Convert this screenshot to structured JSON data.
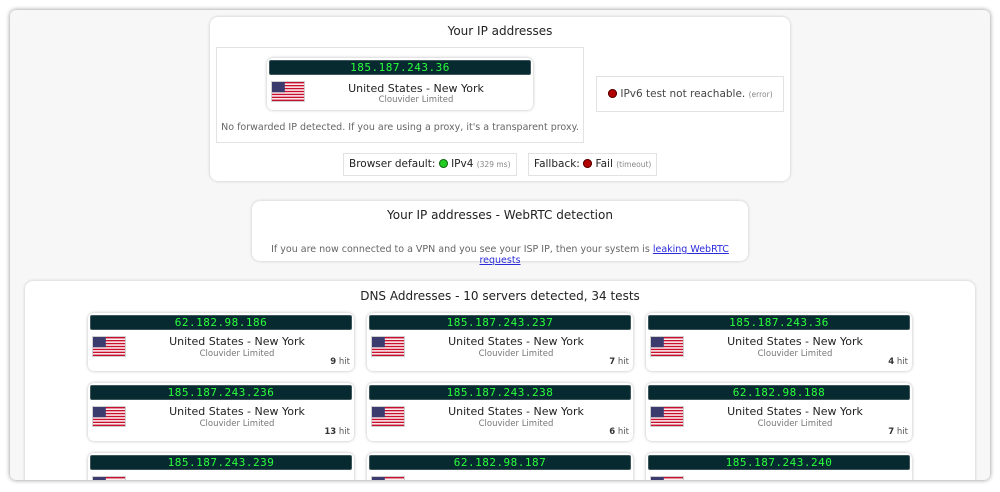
{
  "ip_panel": {
    "title": "Your IP addresses",
    "ipv4": {
      "ip": "185.187.243.36",
      "location": "United States - New York",
      "isp": "Clouvider Limited",
      "flag_icon": "us-flag-icon"
    },
    "forwarded_note": "No forwarded IP detected. If you are using a proxy, it's a transparent proxy.",
    "ipv6": {
      "text": "IPv6 test not reachable.",
      "detail": "(error)",
      "status_color": "#b30000"
    },
    "browser_default": {
      "label": "Browser default:",
      "protocol": "IPv4",
      "detail": "(329 ms)",
      "status_color": "#22cc22"
    },
    "fallback": {
      "label": "Fallback:",
      "result": "Fail",
      "detail": "(timeout)",
      "status_color": "#b30000"
    }
  },
  "webrtc_panel": {
    "title": "Your IP addresses - WebRTC detection",
    "note": "If you are now connected to a VPN and you see your ISP IP, then your system is",
    "link_text": "leaking WebRTC requests"
  },
  "dns_panel": {
    "title": "DNS Addresses - 10 servers detected, 34 tests",
    "hit_suffix": "hit",
    "servers": [
      {
        "ip": "62.182.98.186",
        "location": "United States - New York",
        "isp": "Clouvider Limited",
        "hits": "9"
      },
      {
        "ip": "185.187.243.237",
        "location": "United States - New York",
        "isp": "Clouvider Limited",
        "hits": "7"
      },
      {
        "ip": "185.187.243.36",
        "location": "United States - New York",
        "isp": "Clouvider Limited",
        "hits": "4"
      },
      {
        "ip": "185.187.243.236",
        "location": "United States - New York",
        "isp": "Clouvider Limited",
        "hits": "13"
      },
      {
        "ip": "185.187.243.238",
        "location": "United States - New York",
        "isp": "Clouvider Limited",
        "hits": "6"
      },
      {
        "ip": "62.182.98.188",
        "location": "United States - New York",
        "isp": "Clouvider Limited",
        "hits": "7"
      },
      {
        "ip": "185.187.243.239",
        "location": "",
        "isp": "",
        "hits": ""
      },
      {
        "ip": "62.182.98.187",
        "location": "",
        "isp": "",
        "hits": ""
      },
      {
        "ip": "185.187.243.240",
        "location": "",
        "isp": "",
        "hits": ""
      }
    ]
  },
  "colors": {
    "ip_bar_bg": "#062a30",
    "ip_bar_text": "#2cff3c",
    "link": "#2a2adb"
  }
}
